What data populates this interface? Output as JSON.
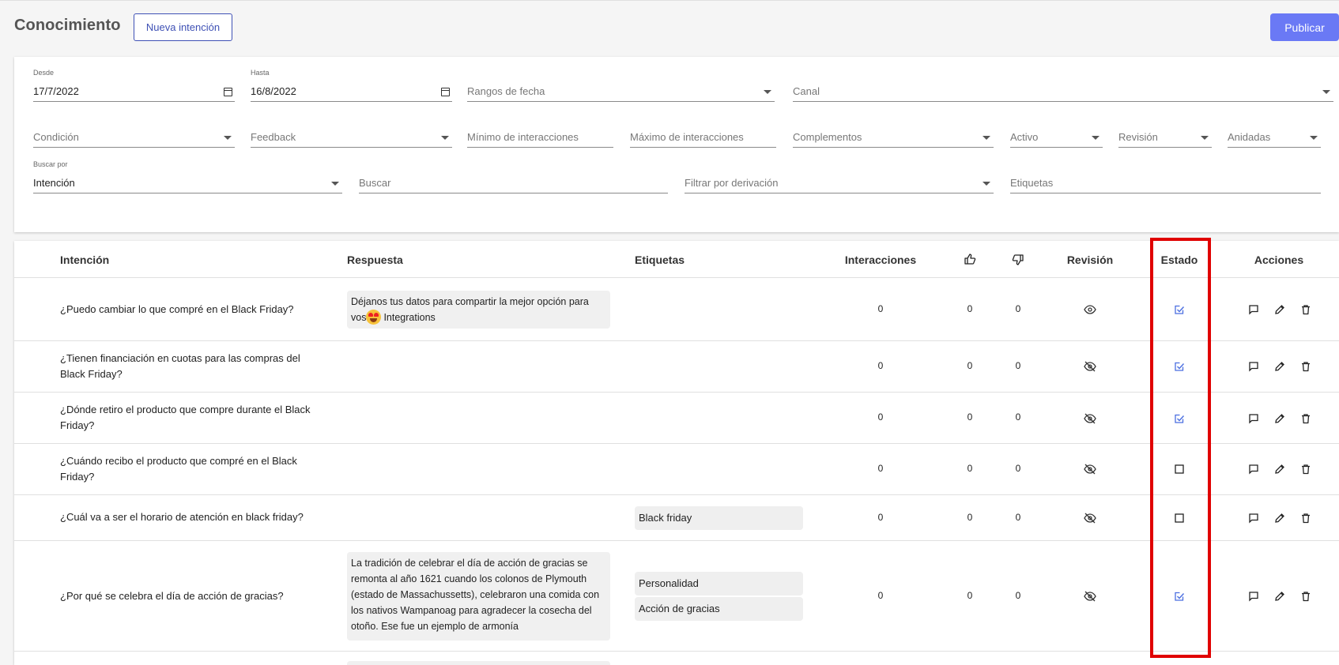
{
  "header": {
    "title": "Conocimiento",
    "new_intent_label": "Nueva intención",
    "publish_label": "Publicar"
  },
  "filters": {
    "desde": {
      "label": "Desde",
      "value": "17/7/2022"
    },
    "hasta": {
      "label": "Hasta",
      "value": "16/8/2022"
    },
    "rangos": "Rangos de fecha",
    "canal": "Canal",
    "condicion": "Condición",
    "feedback": "Feedback",
    "min_inter": "Mínimo de interacciones",
    "max_inter": "Máximo de interacciones",
    "complementos": "Complementos",
    "activo": "Activo",
    "revision": "Revisión",
    "anidadas": "Anidadas",
    "buscar_por": {
      "label": "Buscar por",
      "value": "Intención"
    },
    "buscar": "Buscar",
    "derivacion": "Filtrar por derivación",
    "etiquetas": "Etiquetas"
  },
  "table": {
    "columns": {
      "intencion": "Intención",
      "respuesta": "Respuesta",
      "etiquetas": "Etiquetas",
      "interacciones": "Interacciones",
      "revision": "Revisión",
      "estado": "Estado",
      "acciones": "Acciones"
    },
    "rows": [
      {
        "intent": "¿Puedo cambiar lo que compré en el Black Friday?",
        "response_a": "Déjanos tus datos para compartir la mejor opción para",
        "response_b_pre": "vos",
        "response_b_post": "Integrations",
        "interactions": "0",
        "likes": "0",
        "dislikes": "0",
        "revision": "eye-icon",
        "estado": "checked"
      },
      {
        "intent": "¿Tienen financiación en cuotas para las compras del Black Friday?",
        "interactions": "0",
        "likes": "0",
        "dislikes": "0",
        "revision": "eye-off-icon",
        "estado": "checked"
      },
      {
        "intent": "¿Dónde retiro el producto que compre durante el Black Friday?",
        "interactions": "0",
        "likes": "0",
        "dislikes": "0",
        "revision": "eye-off-icon",
        "estado": "checked"
      },
      {
        "intent": "¿Cuándo recibo el producto que compré en el Black Friday?",
        "interactions": "0",
        "likes": "0",
        "dislikes": "0",
        "revision": "eye-off-icon",
        "estado": "unchecked"
      },
      {
        "intent": "¿Cuál va a ser el horario de atención en black friday?",
        "tags": [
          "Black friday"
        ],
        "interactions": "0",
        "likes": "0",
        "dislikes": "0",
        "revision": "eye-off-icon",
        "estado": "unchecked"
      },
      {
        "intent": "¿Por qué se celebra el día de acción de gracias?",
        "response": "La tradición de celebrar el día de acción de gracias se remonta al año 1621 cuando los colonos de Plymouth (estado de Massachussetts), celebraron una comida con los nativos Wampanoag para agradecer la cosecha del otoño. Ese fue un ejemplo de armonía",
        "tags": [
          "Personalidad",
          "Acción de gracias"
        ],
        "interactions": "0",
        "likes": "0",
        "dislikes": "0",
        "revision": "eye-off-icon",
        "estado": "checked"
      }
    ]
  },
  "colors": {
    "accent": "#6a79f5",
    "highlight": "#e00000",
    "check_blue": "#4a6ee0"
  }
}
